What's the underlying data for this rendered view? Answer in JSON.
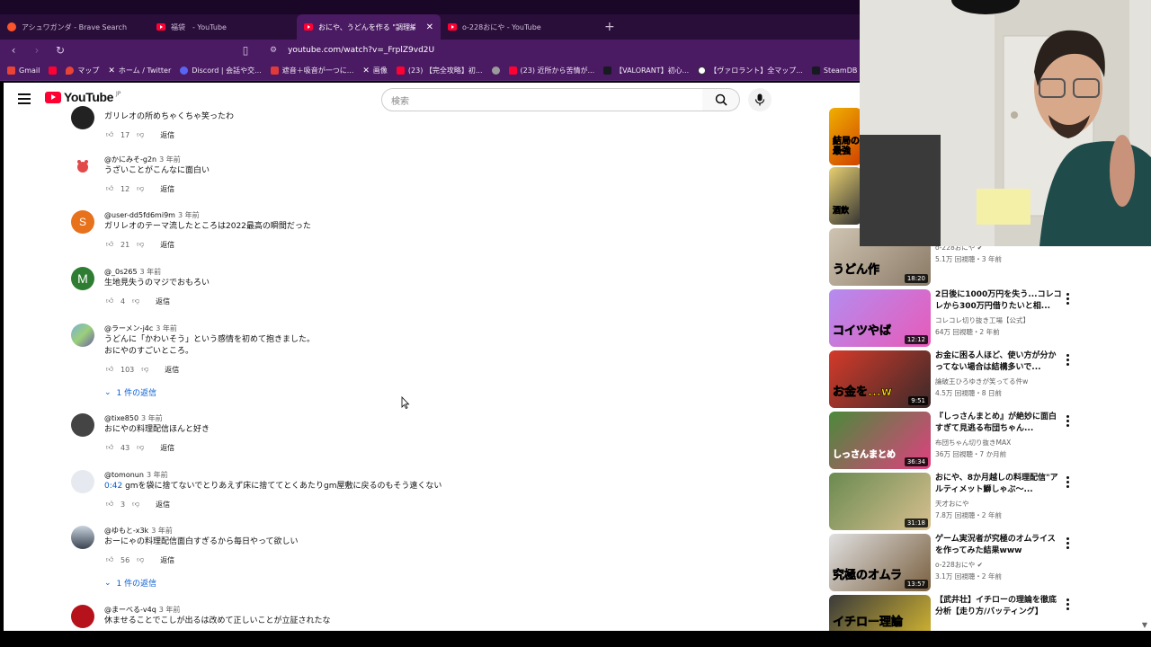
{
  "browser": {
    "tabs": [
      {
        "label": "アシュワガンダ - Brave Search",
        "icon": "brave-icon",
        "active": false
      },
      {
        "label": "福袋　- YouTube",
        "icon": "youtube-icon",
        "active": false
      },
      {
        "label": "おにや、うどんを作る \"調理編\"【2022",
        "icon": "youtube-icon",
        "active": true
      },
      {
        "label": "o-228おにや - YouTube",
        "icon": "youtube-icon",
        "active": false
      }
    ],
    "new_tab": "+",
    "url": "youtube.com/watch?v=_FrplZ9vd2U",
    "bookmarks": [
      {
        "label": "Gmail",
        "icon": "gmail-icon"
      },
      {
        "label": "",
        "icon": "youtube-icon"
      },
      {
        "label": "マップ",
        "icon": "maps-icon"
      },
      {
        "label": "ホーム / Twitter",
        "icon": "x-icon"
      },
      {
        "label": "Discord | 会話や交...",
        "icon": "discord-icon"
      },
      {
        "label": "遮音＋吸音が一つに...",
        "icon": "shop-icon"
      },
      {
        "label": "画像",
        "icon": "x-icon"
      },
      {
        "label": "(23) 【完全攻略】初...",
        "icon": "youtube-icon"
      },
      {
        "label": "",
        "icon": "globe-icon"
      },
      {
        "label": "(23) 近所から苦情が...",
        "icon": "youtube-icon"
      },
      {
        "label": "【VALORANT】初心...",
        "icon": "doc-icon"
      },
      {
        "label": "【ヴァロラント】全マップ...",
        "icon": "valorant-icon"
      },
      {
        "label": "SteamDB",
        "icon": "steam-icon"
      },
      {
        "label": "無",
        "icon": "windows-icon"
      }
    ]
  },
  "youtube": {
    "logo_text": "YouTube",
    "logo_region": "JP",
    "search_placeholder": "検索"
  },
  "comments": [
    {
      "author": "",
      "time": "",
      "text": "ガリレオの所めちゃくちゃ笑ったわ",
      "likes": "17",
      "reply_label": "返信"
    },
    {
      "author": "@かにみそ-g2n",
      "time": "3 年前",
      "text": "うざいことがこんなに面白い",
      "likes": "12",
      "reply_label": "返信"
    },
    {
      "author": "@user-dd5fd6mi9m",
      "time": "3 年前",
      "text": "ガリレオのテーマ流したところは2022最高の瞬間だった",
      "likes": "21",
      "reply_label": "返信",
      "avatar_letter": "S"
    },
    {
      "author": "@_0s265",
      "time": "3 年前",
      "text": "生地見失うのマジでおもろい",
      "likes": "4",
      "reply_label": "返信",
      "avatar_letter": "M"
    },
    {
      "author": "@ラーメン-j4c",
      "time": "3 年前",
      "text": "うどんに「かわいそう」という感情を初めて抱きました。",
      "text2": "おにやのすごいところ。",
      "likes": "103",
      "reply_label": "返信",
      "replies": "1 件の返信"
    },
    {
      "author": "@tixe850",
      "time": "3 年前",
      "text": "おにやの料理配信ほんと好き",
      "likes": "43",
      "reply_label": "返信"
    },
    {
      "author": "@tomonun",
      "time": "3 年前",
      "timestamp": "0:42",
      "text": " gmを袋に捨てないでとりあえず床に捨ててとくあたりgm屋敷に戻るのもそう遠くない",
      "likes": "3",
      "reply_label": "返信"
    },
    {
      "author": "@ゆもと-x3k",
      "time": "3 年前",
      "text": "おーにゃの料理配信面白すぎるから毎日やって欲しい",
      "likes": "56",
      "reply_label": "返信",
      "replies": "1 件の返信"
    },
    {
      "author": "@まーべる-v4q",
      "time": "3 年前",
      "text": "休ませることでこしが出るは改めて正しいことが立証されたな"
    }
  ],
  "sidebar": [
    {
      "title": "",
      "channel": "",
      "stats": "",
      "duration": "",
      "caption": "結局の 最強"
    },
    {
      "title": "",
      "channel": "",
      "stats": "",
      "duration": "",
      "caption": "酒飲"
    },
    {
      "title": "た。",
      "channel": "o-228おにや",
      "stats": "5.1万 回視聴・3 年前",
      "duration": "18:20",
      "caption": "うどん作",
      "verified": true
    },
    {
      "title": "2日後に1000万円を失う...コレコレから300万円借りたいと相...",
      "channel": "コレコレ切り抜き工場【公式】",
      "stats": "64万 回視聴・2 年前",
      "duration": "12:12",
      "caption": "コイツやば"
    },
    {
      "title": "お金に困る人ほど、使い方が分かってない場合は結構多いで...",
      "channel": "論破王ひろゆきが笑ってる件w",
      "stats": "4.5万 回視聴・8 日前",
      "duration": "9:51",
      "caption": "お金を...w"
    },
    {
      "title": "『しっさんまとめ』が絶妙に面白すぎて見逃る布団ちゃん...",
      "channel": "布団ちゃん切り抜きMAX",
      "stats": "36万 回視聴・7 か月前",
      "duration": "36:34",
      "caption": "しっさんまとめ"
    },
    {
      "title": "おにや、8か月越しの料理配信\"アルティメット鰤しゃぶ〜...",
      "channel": "天才おにや",
      "stats": "7.8万 回視聴・2 年前",
      "duration": "31:18",
      "caption": ""
    },
    {
      "title": "ゲーム実況者が究極のオムライスを作ってみた結果www",
      "channel": "o-228おにや",
      "stats": "3.1万 回視聴・2 年前",
      "duration": "13:57",
      "caption": "究極のオムラ",
      "verified": true
    },
    {
      "title": "【武井壮】イチローの理論を徹底分析【走り方/バッティング】",
      "channel": "",
      "stats": "",
      "duration": "",
      "caption": "イチロー理論"
    }
  ]
}
